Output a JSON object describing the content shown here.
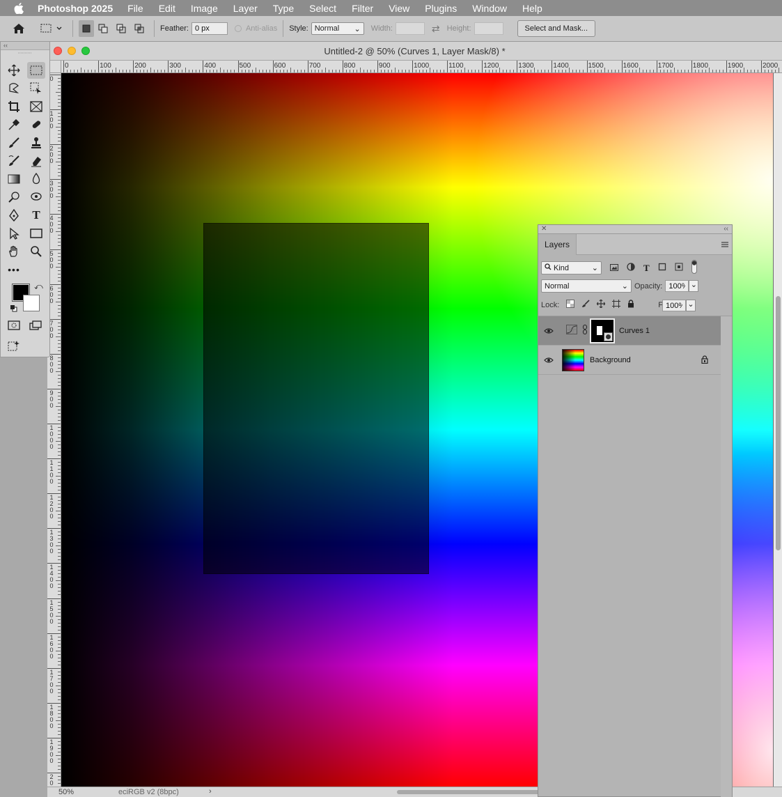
{
  "menubar": {
    "app_name": "Photoshop 2025",
    "items": [
      "File",
      "Edit",
      "Image",
      "Layer",
      "Type",
      "Select",
      "Filter",
      "View",
      "Plugins",
      "Window",
      "Help"
    ]
  },
  "options": {
    "feather_label": "Feather:",
    "feather_value": "0 px",
    "antialias_label": "Anti-alias",
    "style_label": "Style:",
    "style_value": "Normal",
    "width_label": "Width:",
    "height_label": "Height:",
    "select_mask_label": "Select and Mask..."
  },
  "document": {
    "title": "Untitled-2 @ 50% (Curves 1, Layer Mask/8) *",
    "zoom": "50%",
    "profile": "eciRGB v2 (8bpc)",
    "ruler_h": [
      "0",
      "100",
      "200",
      "300",
      "400",
      "500",
      "600",
      "700",
      "800",
      "900",
      "1000",
      "1100",
      "1200",
      "1300",
      "1400",
      "1500",
      "1600",
      "1700",
      "1800",
      "1900",
      "2000"
    ],
    "ruler_v": [
      "0",
      "1\n0\n0",
      "2\n0\n0",
      "3\n0\n0",
      "4\n0\n0",
      "5\n0\n0",
      "6\n0\n0",
      "7\n0\n0",
      "8\n0\n0",
      "9\n0\n0",
      "1\n0\n0\n0",
      "1\n1\n0\n0",
      "1\n2\n0\n0",
      "1\n3\n0\n0",
      "1\n4\n0\n0",
      "1\n5\n0\n0",
      "1\n6\n0\n0",
      "1\n7\n0\n0",
      "1\n8\n0\n0",
      "1\n9\n0\n0",
      "2\n0"
    ]
  },
  "layers_panel": {
    "tab_label": "Layers",
    "filter_kind": "Kind",
    "blend_mode": "Normal",
    "opacity_label": "Opacity:",
    "opacity_value": "100%",
    "lock_label": "Lock:",
    "fill_label": "Fill:",
    "fill_value": "100%",
    "layers": [
      {
        "name": "Curves 1",
        "selected": true,
        "type": "adjustment"
      },
      {
        "name": "Background",
        "selected": false,
        "type": "pixel",
        "locked": true
      }
    ]
  },
  "colors": {
    "foreground": "#000000",
    "background": "#ffffff"
  }
}
